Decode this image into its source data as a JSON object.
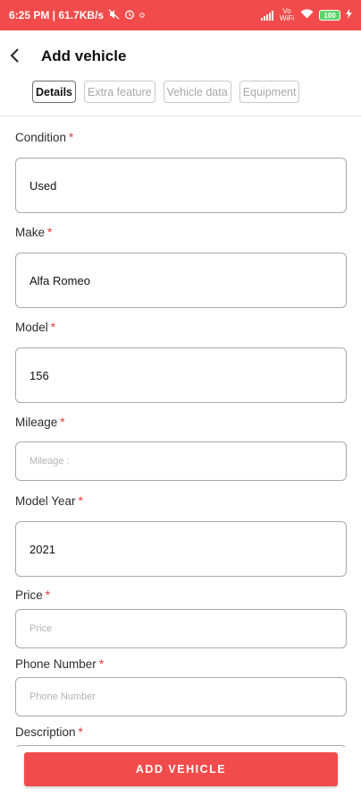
{
  "status_bar": {
    "time_speed": "6:25 PM | 61.7KB/s",
    "network_label": "Vo WiFi",
    "battery": "100"
  },
  "header": {
    "title": "Add vehicle",
    "tabs": [
      {
        "label": "Details",
        "active": true
      },
      {
        "label": "Extra feature",
        "active": false
      },
      {
        "label": "Vehicle data",
        "active": false
      },
      {
        "label": "Equipment",
        "active": false
      }
    ]
  },
  "form": {
    "fields": [
      {
        "label": "Condition",
        "required": "*",
        "value": "Used",
        "placeholder": ""
      },
      {
        "label": "Make",
        "required": "*",
        "value": "Alfa Romeo",
        "placeholder": ""
      },
      {
        "label": "Model",
        "required": "*",
        "value": "156",
        "placeholder": ""
      },
      {
        "label": "Mileage",
        "required": "*",
        "value": "",
        "placeholder": "Mileage :"
      },
      {
        "label": "Model Year",
        "required": "*",
        "value": "2021",
        "placeholder": ""
      },
      {
        "label": "Price",
        "required": "*",
        "value": "",
        "placeholder": "Price"
      },
      {
        "label": "Phone Number",
        "required": "*",
        "value": "",
        "placeholder": "Phone Number"
      },
      {
        "label": "Description",
        "required": "*",
        "value": "",
        "placeholder": ""
      }
    ]
  },
  "footer": {
    "submit_label": "ADD VEHICLE"
  },
  "colors": {
    "accent": "#f24b4b",
    "required": "#e53935"
  }
}
